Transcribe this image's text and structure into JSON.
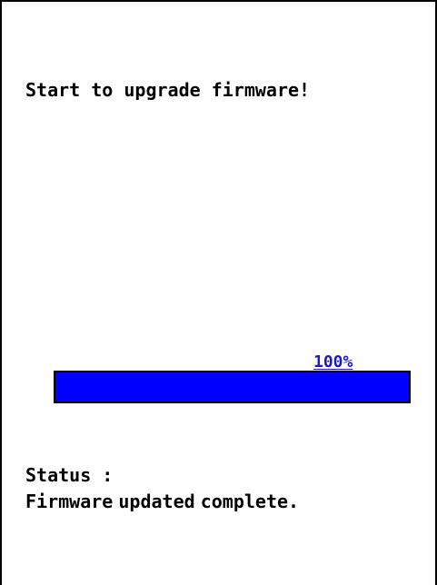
{
  "heading": "Start to upgrade firmware!",
  "progress": {
    "percent_label": "100%",
    "value": 100,
    "fill_color": "#0000ff",
    "label_color": "#1a1acc"
  },
  "status": {
    "label": "Status :",
    "message": "Firmware updated complete."
  }
}
